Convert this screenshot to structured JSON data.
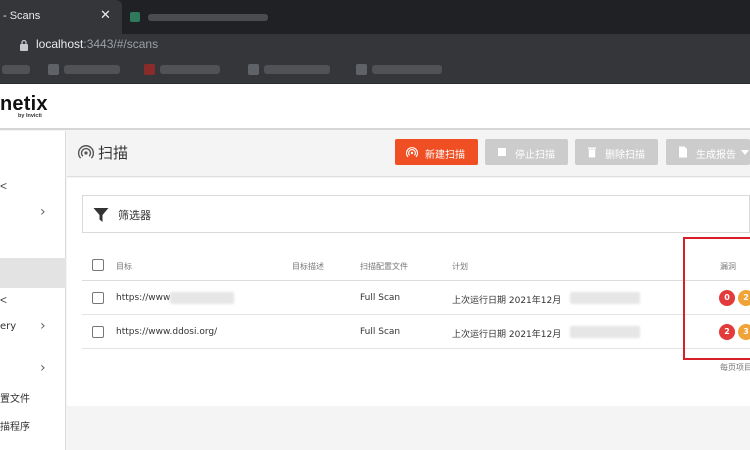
{
  "browser": {
    "tab_title": "- Scans",
    "tab_close": "✕",
    "url_host": "localhost",
    "url_rest": ":3443/#/scans"
  },
  "app": {
    "logo": "netix",
    "logo_sub": "by Invicti"
  },
  "sidebar": {
    "marks": [
      "<",
      "<"
    ],
    "chevrons": [
      "›",
      "›",
      "›"
    ],
    "labels": [
      "ery",
      "置文件",
      "描程序"
    ]
  },
  "page": {
    "title": "扫描",
    "buttons": {
      "new_scan": "新建扫描",
      "stop_scan": "停止扫描",
      "delete_scan": "删除扫描",
      "generate_report": "生成报告"
    },
    "filter_label": "筛选器"
  },
  "table": {
    "headers": {
      "target": "目标",
      "description": "目标描述",
      "profile": "扫描配置文件",
      "schedule": "计划",
      "vulns": "漏洞"
    },
    "rows": [
      {
        "target": "https://www",
        "profile": "Full Scan",
        "schedule": "上次运行日期 2021年12月",
        "vuln_a": "0",
        "vuln_b": "2"
      },
      {
        "target": "https://www.ddosi.org/",
        "profile": "Full Scan",
        "schedule": "上次运行日期 2021年12月",
        "vuln_a": "2",
        "vuln_b": "3"
      }
    ],
    "per_page": "每页项目"
  },
  "colors": {
    "accent": "#f04f23",
    "vuln_high": "#e23b3b",
    "vuln_medium": "#f0a336",
    "highlight_box": "#d61f26"
  }
}
